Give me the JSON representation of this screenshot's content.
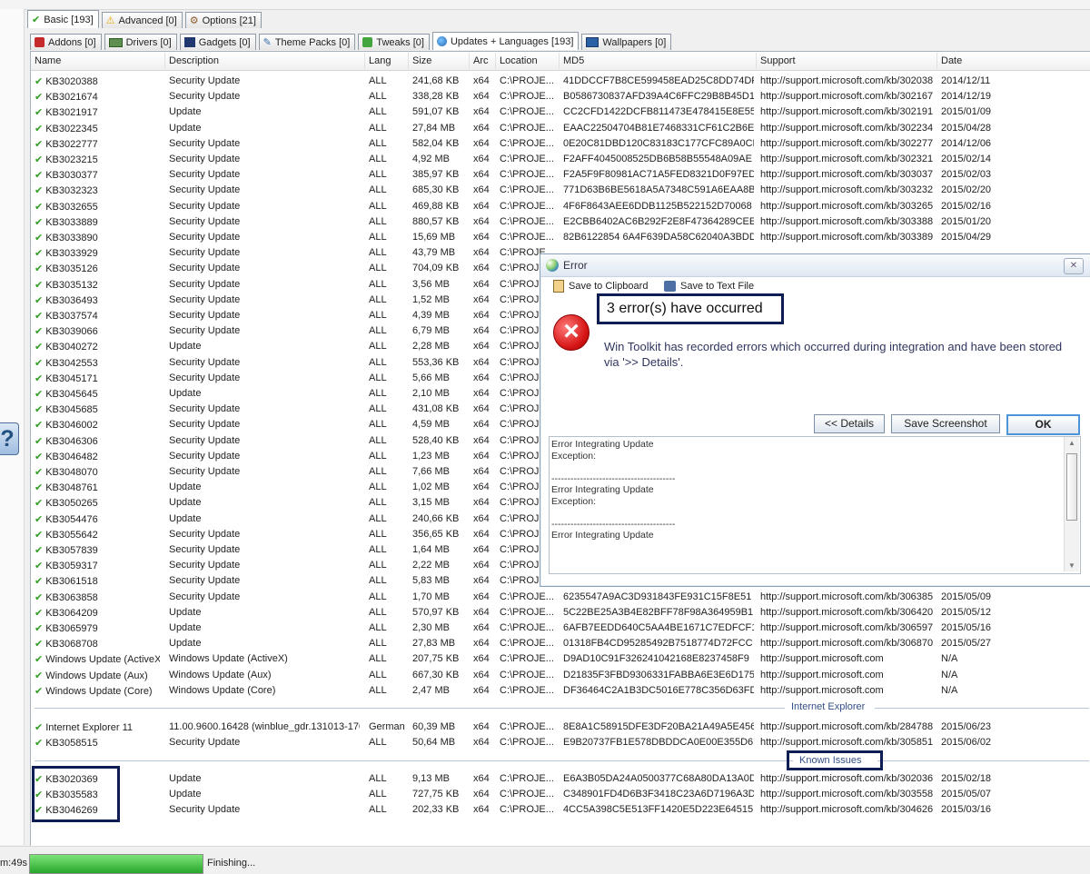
{
  "tabs_primary": [
    {
      "label": "Basic [193]",
      "icon": "checkmark-icon",
      "active": true
    },
    {
      "label": "Advanced [0]",
      "icon": "warning-icon",
      "active": false
    },
    {
      "label": "Options [21]",
      "icon": "gear-icon",
      "active": false
    }
  ],
  "tabs_secondary": [
    {
      "label": "Addons [0]",
      "icon": "addons-icon",
      "active": false
    },
    {
      "label": "Drivers [0]",
      "icon": "drivers-icon",
      "active": false
    },
    {
      "label": "Gadgets [0]",
      "icon": "gadgets-icon",
      "active": false
    },
    {
      "label": "Theme Packs [0]",
      "icon": "theme-packs-icon",
      "active": false
    },
    {
      "label": "Tweaks [0]",
      "icon": "tweaks-icon",
      "active": false
    },
    {
      "label": "Updates + Languages [193]",
      "icon": "globe-icon",
      "active": true
    },
    {
      "label": "Wallpapers [0]",
      "icon": "wallpapers-icon",
      "active": false
    }
  ],
  "columns": [
    "Name",
    "Description",
    "Lang",
    "Size",
    "Arc",
    "Location",
    "MD5",
    "Support",
    "Date"
  ],
  "rows": [
    [
      "KB3020388",
      "Security Update",
      "ALL",
      "241,68 KB",
      "x64",
      "C:\\PROJE...",
      "41DDCCF7B8CE599458EAD25C8DD74DF6",
      "http://support.microsoft.com/kb/3020388",
      "2014/12/11"
    ],
    [
      "KB3021674",
      "Security Update",
      "ALL",
      "338,28 KB",
      "x64",
      "C:\\PROJE...",
      "B0586730837AFD39A4C6FFC29B8B45D1",
      "http://support.microsoft.com/kb/3021674",
      "2014/12/19"
    ],
    [
      "KB3021917",
      "Update",
      "ALL",
      "591,07 KB",
      "x64",
      "C:\\PROJE...",
      "CC2CFD1422DCFB811473E478415E8E55",
      "http://support.microsoft.com/kb/3021917",
      "2015/01/09"
    ],
    [
      "KB3022345",
      "Update",
      "ALL",
      "27,84 MB",
      "x64",
      "C:\\PROJE...",
      "EAAC22504704B81E7468331CF61C2B6E",
      "http://support.microsoft.com/kb/3022345",
      "2015/04/28"
    ],
    [
      "KB3022777",
      "Security Update",
      "ALL",
      "582,04 KB",
      "x64",
      "C:\\PROJE...",
      "0E20C81DBD120C83183C177CFC89A0CD",
      "http://support.microsoft.com/kb/3022777",
      "2014/12/06"
    ],
    [
      "KB3023215",
      "Security Update",
      "ALL",
      "4,92 MB",
      "x64",
      "C:\\PROJE...",
      "F2AFF4045008525DB6B58B55548A09AE",
      "http://support.microsoft.com/kb/3023215",
      "2015/02/14"
    ],
    [
      "KB3030377",
      "Security Update",
      "ALL",
      "385,97 KB",
      "x64",
      "C:\\PROJE...",
      "F2A5F9F80981AC71A5FED8321D0F97ED",
      "http://support.microsoft.com/kb/3030377",
      "2015/02/03"
    ],
    [
      "KB3032323",
      "Security Update",
      "ALL",
      "685,30 KB",
      "x64",
      "C:\\PROJE...",
      "771D63B6BE5618A5A7348C591A6EAA8B",
      "http://support.microsoft.com/kb/3032323",
      "2015/02/20"
    ],
    [
      "KB3032655",
      "Security Update",
      "ALL",
      "469,88 KB",
      "x64",
      "C:\\PROJE...",
      "4F6F8643AEE6DDB1125B522152D70068",
      "http://support.microsoft.com/kb/3032655",
      "2015/02/16"
    ],
    [
      "KB3033889",
      "Security Update",
      "ALL",
      "880,57 KB",
      "x64",
      "C:\\PROJE...",
      "E2CBB6402AC6B292F2E8F47364289CEE",
      "http://support.microsoft.com/kb/3033889",
      "2015/01/20"
    ],
    [
      "KB3033890",
      "Security Update",
      "ALL",
      "15,69 MB",
      "x64",
      "C:\\PROJE...",
      "82B6122854 6A4F639DA58C62040A3BDD",
      "http://support.microsoft.com/kb/3033890",
      "2015/04/29"
    ],
    [
      "KB3033929",
      "Security Update",
      "ALL",
      "43,79 MB",
      "x64",
      "C:\\PROJE...",
      "",
      "",
      ""
    ],
    [
      "KB3035126",
      "Security Update",
      "ALL",
      "704,09 KB",
      "x64",
      "C:\\PROJE...",
      "",
      "",
      ""
    ],
    [
      "KB3035132",
      "Security Update",
      "ALL",
      "3,56 MB",
      "x64",
      "C:\\PROJE...",
      "",
      "",
      ""
    ],
    [
      "KB3036493",
      "Security Update",
      "ALL",
      "1,52 MB",
      "x64",
      "C:\\PROJE...",
      "",
      "",
      ""
    ],
    [
      "KB3037574",
      "Security Update",
      "ALL",
      "4,39 MB",
      "x64",
      "C:\\PROJE...",
      "",
      "",
      ""
    ],
    [
      "KB3039066",
      "Security Update",
      "ALL",
      "6,79 MB",
      "x64",
      "C:\\PROJE...",
      "",
      "",
      ""
    ],
    [
      "KB3040272",
      "Update",
      "ALL",
      "2,28 MB",
      "x64",
      "C:\\PROJE...",
      "",
      "",
      ""
    ],
    [
      "KB3042553",
      "Security Update",
      "ALL",
      "553,36 KB",
      "x64",
      "C:\\PROJE...",
      "",
      "",
      ""
    ],
    [
      "KB3045171",
      "Security Update",
      "ALL",
      "5,66 MB",
      "x64",
      "C:\\PROJE...",
      "",
      "",
      ""
    ],
    [
      "KB3045645",
      "Update",
      "ALL",
      "2,10 MB",
      "x64",
      "C:\\PROJE...",
      "",
      "",
      ""
    ],
    [
      "KB3045685",
      "Security Update",
      "ALL",
      "431,08 KB",
      "x64",
      "C:\\PROJE...",
      "",
      "",
      ""
    ],
    [
      "KB3046002",
      "Security Update",
      "ALL",
      "4,59 MB",
      "x64",
      "C:\\PROJE...",
      "",
      "",
      ""
    ],
    [
      "KB3046306",
      "Security Update",
      "ALL",
      "528,40 KB",
      "x64",
      "C:\\PROJE...",
      "",
      "",
      ""
    ],
    [
      "KB3046482",
      "Security Update",
      "ALL",
      "1,23 MB",
      "x64",
      "C:\\PROJE...",
      "",
      "",
      ""
    ],
    [
      "KB3048070",
      "Security Update",
      "ALL",
      "7,66 MB",
      "x64",
      "C:\\PROJE...",
      "",
      "",
      ""
    ],
    [
      "KB3048761",
      "Update",
      "ALL",
      "1,02 MB",
      "x64",
      "C:\\PROJE...",
      "",
      "",
      ""
    ],
    [
      "KB3050265",
      "Update",
      "ALL",
      "3,15 MB",
      "x64",
      "C:\\PROJE...",
      "",
      "",
      ""
    ],
    [
      "KB3054476",
      "Update",
      "ALL",
      "240,66 KB",
      "x64",
      "C:\\PROJE...",
      "",
      "",
      ""
    ],
    [
      "KB3055642",
      "Security Update",
      "ALL",
      "356,65 KB",
      "x64",
      "C:\\PROJE...",
      "",
      "",
      ""
    ],
    [
      "KB3057839",
      "Security Update",
      "ALL",
      "1,64 MB",
      "x64",
      "C:\\PROJE...",
      "",
      "",
      ""
    ],
    [
      "KB3059317",
      "Security Update",
      "ALL",
      "2,22 MB",
      "x64",
      "C:\\PROJE...",
      "",
      "",
      ""
    ],
    [
      "KB3061518",
      "Security Update",
      "ALL",
      "5,83 MB",
      "x64",
      "C:\\PROJE...",
      "",
      "",
      ""
    ],
    [
      "KB3063858",
      "Security Update",
      "ALL",
      "1,70 MB",
      "x64",
      "C:\\PROJE...",
      "6235547A9AC3D931843FE931C15F8E51",
      "http://support.microsoft.com/kb/3063858",
      "2015/05/09"
    ],
    [
      "KB3064209",
      "Update",
      "ALL",
      "570,97 KB",
      "x64",
      "C:\\PROJE...",
      "5C22BE25A3B4E82BFF78F98A364959B1",
      "http://support.microsoft.com/kb/3064209",
      "2015/05/12"
    ],
    [
      "KB3065979",
      "Update",
      "ALL",
      "2,30 MB",
      "x64",
      "C:\\PROJE...",
      "6AFB7EEDD640C5AA4BE1671C7EDFCF10",
      "http://support.microsoft.com/kb/3065979",
      "2015/05/16"
    ],
    [
      "KB3068708",
      "Update",
      "ALL",
      "27,83 MB",
      "x64",
      "C:\\PROJE...",
      "01318FB4CD95285492B7518774D72FCC",
      "http://support.microsoft.com/kb/3068708",
      "2015/05/27"
    ],
    [
      "Windows Update (ActiveX)",
      "Windows Update (ActiveX)",
      "ALL",
      "207,75 KB",
      "x64",
      "C:\\PROJE...",
      "D9AD10C91F326241042168E8237458F9",
      "http://support.microsoft.com",
      "N/A"
    ],
    [
      "Windows Update (Aux)",
      "Windows Update (Aux)",
      "ALL",
      "667,30 KB",
      "x64",
      "C:\\PROJE...",
      "D21835F3FBD9306331FABBA6E3E6D175",
      "http://support.microsoft.com",
      "N/A"
    ],
    [
      "Windows Update (Core)",
      "Windows Update (Core)",
      "ALL",
      "2,47 MB",
      "x64",
      "C:\\PROJE...",
      "DF36464C2A1B3DC5016E778C356D63FD",
      "http://support.microsoft.com",
      "N/A"
    ]
  ],
  "group_internet_explorer": {
    "label": "Internet Explorer",
    "rows": [
      [
        "Internet Explorer 11",
        "11.00.9600.16428 (winblue_gdr.131013-1700)",
        "German",
        "60,39 MB",
        "x64",
        "C:\\PROJE...",
        "8E8A1C58915DFE3DF20BA21A49A5E456",
        "http://support.microsoft.com/kb/2847882",
        "2015/06/23"
      ],
      [
        "KB3058515",
        "Security Update",
        "ALL",
        "50,64 MB",
        "x64",
        "C:\\PROJE...",
        "E9B20737FB1E578DBDDCA0E00E355D61",
        "http://support.microsoft.com/kb/3058515",
        "2015/06/02"
      ]
    ]
  },
  "group_known_issues": {
    "label": "Known Issues",
    "rows": [
      [
        "KB3020369",
        "Update",
        "ALL",
        "9,13 MB",
        "x64",
        "C:\\PROJE...",
        "E6A3B05DA24A0500377C68A80DA13A0D",
        "http://support.microsoft.com/kb/3020369",
        "2015/02/18"
      ],
      [
        "KB3035583",
        "Update",
        "ALL",
        "727,75 KB",
        "x64",
        "C:\\PROJE...",
        "C348901FD4D6B3F3418C23A6D7196A3D",
        "http://support.microsoft.com/kb/3035583",
        "2015/05/07"
      ],
      [
        "KB3046269",
        "Security Update",
        "ALL",
        "202,33 KB",
        "x64",
        "C:\\PROJE...",
        "4CC5A398C5E513FF1420E5D223E64515",
        "http://support.microsoft.com/kb/3046269",
        "2015/03/16"
      ]
    ]
  },
  "status": {
    "elapsed": "m:49s",
    "progress_percent": 100,
    "text": "Finishing..."
  },
  "dialog": {
    "title": "Error",
    "save_clipboard": "Save to Clipboard",
    "save_text_file": "Save to Text File",
    "heading": "3 error(s) have occurred",
    "message": "Win Toolkit has recorded errors which occurred during integration and have been stored via '>> Details'.",
    "details_button": "<< Details",
    "save_screenshot": "Save Screenshot",
    "ok": "OK",
    "details": "Error Integrating Update\nException:\n\n---------------------------------------\nError Integrating Update\nException:\n\n---------------------------------------\nError Integrating Update"
  }
}
